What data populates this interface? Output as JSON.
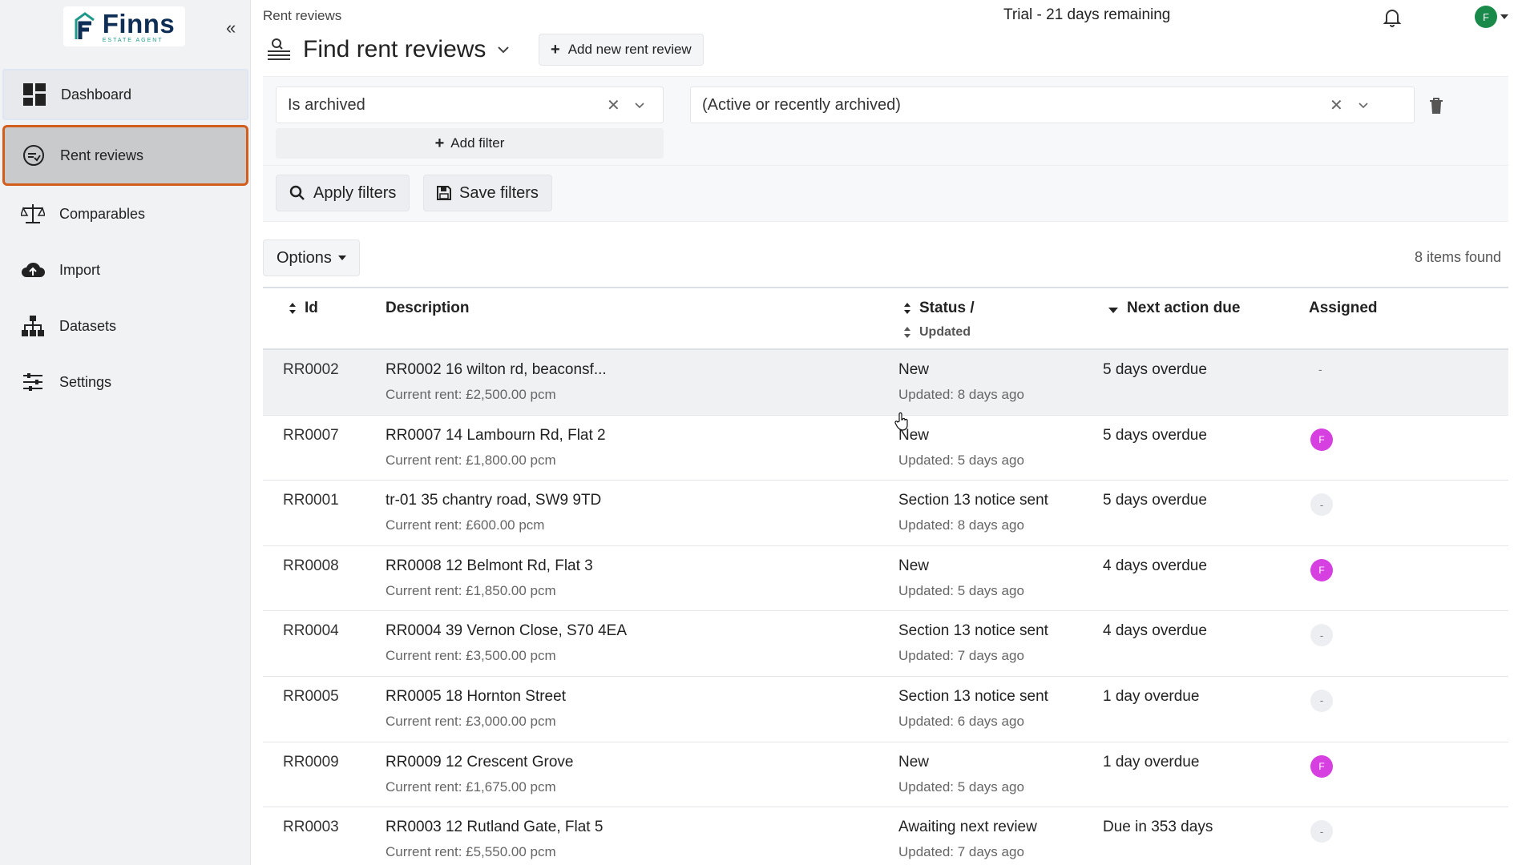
{
  "sidebar": {
    "logo": {
      "title": "Finns",
      "subtitle": "ESTATE AGENT"
    },
    "collapse_label": "«",
    "items": [
      {
        "label": "Dashboard",
        "icon": "dashboard-grid-icon"
      },
      {
        "label": "Rent reviews",
        "icon": "rent-review-icon",
        "active": true
      },
      {
        "label": "Comparables",
        "icon": "scales-icon"
      },
      {
        "label": "Import",
        "icon": "cloud-upload-icon"
      },
      {
        "label": "Datasets",
        "icon": "hierarchy-icon"
      },
      {
        "label": "Settings",
        "icon": "sliders-icon"
      }
    ]
  },
  "header": {
    "breadcrumb": "Rent reviews",
    "trial": "Trial - 21 days remaining",
    "avatar_initial": "F",
    "page_title": "Find rent reviews",
    "add_button": "Add new rent review"
  },
  "filters": {
    "field": "Is archived",
    "value": "(Active or recently archived)",
    "add_filter": "Add filter",
    "apply": "Apply filters",
    "save": "Save filters",
    "clear_glyph": "✕"
  },
  "toolbar": {
    "options": "Options",
    "items_found": "8 items found"
  },
  "table": {
    "columns": {
      "id": "Id",
      "description": "Description",
      "status": "Status /",
      "updated": "Updated",
      "next_action": "Next action due",
      "assigned": "Assigned"
    },
    "rows": [
      {
        "id": "RR0002",
        "description": "RR0002 16 wilton rd, beaconsf...",
        "rent": "Current rent: £2,500.00 pcm",
        "status": "New",
        "updated": "Updated: 8 days ago",
        "due": "5 days overdue",
        "assigned": "-"
      },
      {
        "id": "RR0007",
        "description": "RR0007 14 Lambourn Rd, Flat 2",
        "rent": "Current rent: £1,800.00 pcm",
        "status": "New",
        "updated": "Updated: 5 days ago",
        "due": "5 days overdue",
        "assigned": "F"
      },
      {
        "id": "RR0001",
        "description": "tr-01 35 chantry road, SW9 9TD",
        "rent": "Current rent: £600.00 pcm",
        "status": "Section 13 notice sent",
        "updated": "Updated: 8 days ago",
        "due": "5 days overdue",
        "assigned": "-"
      },
      {
        "id": "RR0008",
        "description": "RR0008 12 Belmont Rd, Flat 3",
        "rent": "Current rent: £1,850.00 pcm",
        "status": "New",
        "updated": "Updated: 5 days ago",
        "due": "4 days overdue",
        "assigned": "F"
      },
      {
        "id": "RR0004",
        "description": "RR0004 39 Vernon Close, S70 4EA",
        "rent": "Current rent: £3,500.00 pcm",
        "status": "Section 13 notice sent",
        "updated": "Updated: 7 days ago",
        "due": "4 days overdue",
        "assigned": "-"
      },
      {
        "id": "RR0005",
        "description": "RR0005 18 Hornton Street",
        "rent": "Current rent: £3,000.00 pcm",
        "status": "Section 13 notice sent",
        "updated": "Updated: 6 days ago",
        "due": "1 day overdue",
        "assigned": "-"
      },
      {
        "id": "RR0009",
        "description": "RR0009 12 Crescent Grove",
        "rent": "Current rent: £1,675.00 pcm",
        "status": "New",
        "updated": "Updated: 5 days ago",
        "due": "1 day overdue",
        "assigned": "F"
      },
      {
        "id": "RR0003",
        "description": "RR0003 12 Rutland Gate, Flat 5",
        "rent": "Current rent: £5,550.00 pcm",
        "status": "Awaiting next review",
        "updated": "Updated: 7 days ago",
        "due": "Due in 353 days",
        "assigned": "-"
      }
    ]
  },
  "colors": {
    "highlight_border": "#d35e1c",
    "assigned_avatar": "#d640e0",
    "user_avatar": "#1a8a4a",
    "logo_navy": "#0f2e55",
    "logo_teal": "#1f9a8a"
  }
}
